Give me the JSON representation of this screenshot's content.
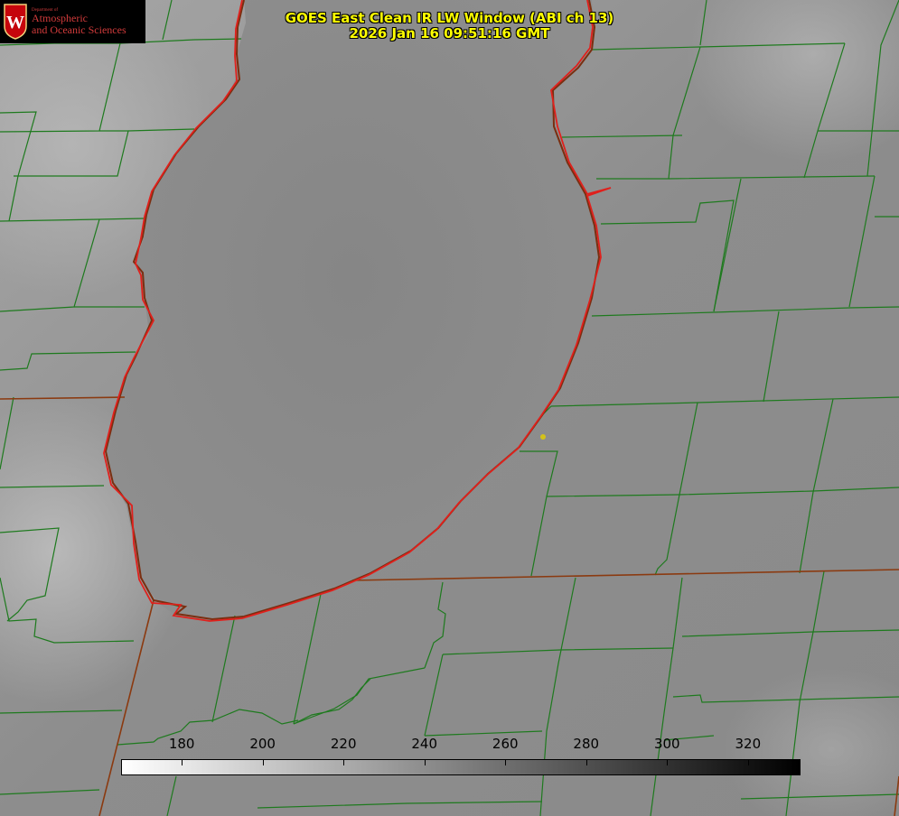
{
  "title": {
    "line1": "GOES East Clean IR LW Window (ABI ch 13)",
    "line2": "2026 Jan 16 09:51:16 GMT"
  },
  "logo": {
    "department": "Department of",
    "org_line1": "Atmospheric",
    "org_line2": "and Oceanic Sciences",
    "emblem": "uw-crest-icon"
  },
  "colorbar": {
    "min": 165,
    "max": 333,
    "ticks": [
      "180",
      "200",
      "220",
      "240",
      "260",
      "280",
      "300",
      "320"
    ],
    "gradient_start": "#ffffff",
    "gradient_end": "#000000"
  },
  "colors": {
    "shoreline": "#e0201c",
    "county_lines": "#1e7a1e",
    "state_lines": "#8b3a10",
    "point_marker": "#d4c21a",
    "title_text": "#ffff00"
  }
}
